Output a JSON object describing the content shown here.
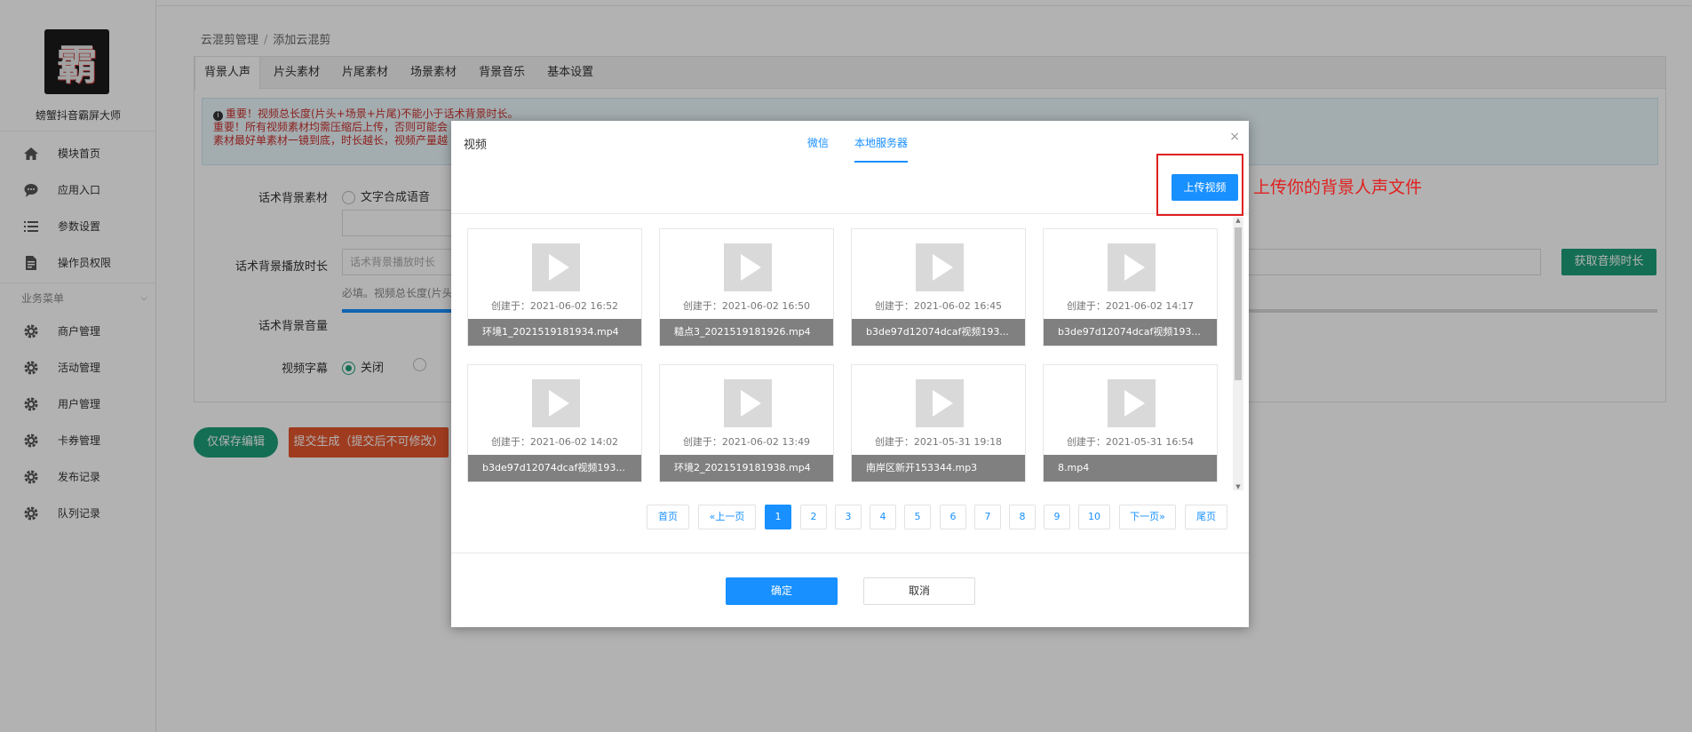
{
  "sidebar": {
    "logo_glyph": "霸",
    "brand": "螃蟹抖音霸屏大师",
    "items_top": [
      {
        "label": "模块首页",
        "icon": "home-icon"
      },
      {
        "label": "应用入口",
        "icon": "chat-icon"
      },
      {
        "label": "参数设置",
        "icon": "list-icon"
      },
      {
        "label": "操作员权限",
        "icon": "document-icon"
      }
    ],
    "group": "业务菜单",
    "items_biz": [
      {
        "label": "商户管理",
        "icon": "gear-icon"
      },
      {
        "label": "活动管理",
        "icon": "gear-icon"
      },
      {
        "label": "用户管理",
        "icon": "gear-icon"
      },
      {
        "label": "卡券管理",
        "icon": "gear-icon"
      },
      {
        "label": "发布记录",
        "icon": "gear-icon"
      },
      {
        "label": "队列记录",
        "icon": "gear-icon"
      }
    ]
  },
  "breadcrumb": {
    "root": "云混剪管理",
    "sep": "/",
    "current": "添加云混剪"
  },
  "tabs": [
    "背景人声",
    "片头素材",
    "片尾素材",
    "场景素材",
    "背景音乐",
    "基本设置"
  ],
  "notice": {
    "line1": "重要！视频总长度(片头+场景+片尾)不能小于话术背景时长。",
    "line2": "重要！所有视频素材均需压缩后上传，否则可能会",
    "line3": "素材最好单素材一镜到底，时长越长，视频产量越"
  },
  "form": {
    "material_label": "话术背景素材",
    "material_option": "文字合成语音",
    "duration_label": "话术背景播放时长",
    "duration_placeholder": "话术背景播放时长",
    "duration_hint": "必填。视频总长度(片头",
    "volume_label": "话术背景音量",
    "volume_level": 0.09,
    "subtitle_label": "视频字幕",
    "subtitle_off": "关闭",
    "get_duration_btn": "获取音频时长"
  },
  "actions": {
    "save": "仅保存编辑",
    "submit": "提交生成（提交后不可修改）"
  },
  "modal": {
    "title": "视频",
    "tab_wechat": "微信",
    "tab_local": "本地服务器",
    "close": "×",
    "upload_btn": "上传视频",
    "annotation": "上传你的背景人声文件",
    "ok": "确定",
    "cancel": "取消",
    "files": [
      {
        "date": "创建于：2021-06-02 16:52",
        "name": "环境1_2021519181934.mp4"
      },
      {
        "date": "创建于：2021-06-02 16:50",
        "name": "糙点3_2021519181926.mp4"
      },
      {
        "date": "创建于：2021-06-02 16:45",
        "name": "b3de97d12074dcaf视频193..."
      },
      {
        "date": "创建于：2021-06-02 14:17",
        "name": "b3de97d12074dcaf视频193..."
      },
      {
        "date": "创建于：2021-06-02 14:02",
        "name": "b3de97d12074dcaf视频193..."
      },
      {
        "date": "创建于：2021-06-02 13:49",
        "name": "环境2_2021519181938.mp4"
      },
      {
        "date": "创建于：2021-05-31 19:18",
        "name": "南岸区新开153344.mp3"
      },
      {
        "date": "创建于：2021-05-31 16:54",
        "name": "8.mp4"
      }
    ],
    "pager": {
      "first": "首页",
      "prev": "«上一页",
      "pages": [
        "1",
        "2",
        "3",
        "4",
        "5",
        "6",
        "7",
        "8",
        "9",
        "10"
      ],
      "current": "1",
      "next": "下一页»",
      "last": "尾页"
    }
  },
  "colors": {
    "accent": "#1890ff",
    "green": "#1e9e78",
    "annotation_red": "#e02020",
    "submit_orange": "#e4572e"
  }
}
